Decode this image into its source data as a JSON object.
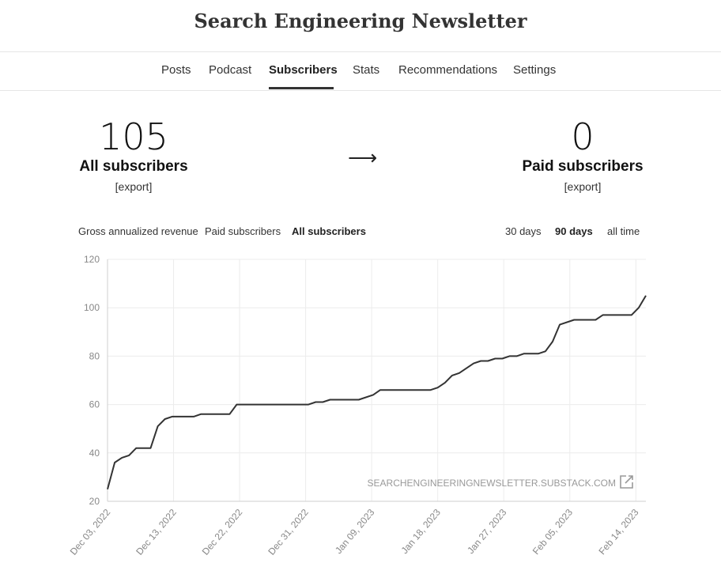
{
  "header": {
    "title": "Search Engineering Newsletter"
  },
  "nav": {
    "items": [
      "Posts",
      "Podcast",
      "Subscribers",
      "Stats",
      "Recommendations",
      "Settings"
    ],
    "active": "Subscribers"
  },
  "stats": {
    "all": {
      "value": "105",
      "label": "All subscribers",
      "export": "[export]"
    },
    "arrow": "⟶",
    "paid": {
      "value": "0",
      "label": "Paid subscribers",
      "export": "[export]"
    }
  },
  "metric_tabs": {
    "items": [
      "Gross annualized revenue",
      "Paid subscribers",
      "All subscribers"
    ],
    "active": "All subscribers"
  },
  "range_tabs": {
    "items": [
      "30 days",
      "90 days",
      "all time"
    ],
    "active": "90 days"
  },
  "watermark": "SEARCHENGINEERINGNEWSLETTER.SUBSTACK.COM",
  "chart_data": {
    "type": "line",
    "ylim": [
      20,
      120
    ],
    "yticks": [
      20,
      40,
      60,
      80,
      100,
      120
    ],
    "xticks": [
      "Dec 03, 2022",
      "Dec 13, 2022",
      "Dec 22, 2022",
      "Dec 31, 2022",
      "Jan 09, 2023",
      "Jan 18, 2023",
      "Jan 27, 2023",
      "Feb 05, 2023",
      "Feb 14, 2023"
    ],
    "x_start": "2022-12-03",
    "x_end": "2023-02-15",
    "grid": true,
    "series": [
      {
        "color": "#333333",
        "points": [
          [
            "2022-12-03",
            25
          ],
          [
            "2022-12-04",
            36
          ],
          [
            "2022-12-05",
            38
          ],
          [
            "2022-12-06",
            39
          ],
          [
            "2022-12-07",
            42
          ],
          [
            "2022-12-09",
            42
          ],
          [
            "2022-12-10",
            51
          ],
          [
            "2022-12-11",
            54
          ],
          [
            "2022-12-12",
            55
          ],
          [
            "2022-12-15",
            55
          ],
          [
            "2022-12-16",
            56
          ],
          [
            "2022-12-20",
            56
          ],
          [
            "2022-12-21",
            60
          ],
          [
            "2022-12-31",
            60
          ],
          [
            "2023-01-01",
            61
          ],
          [
            "2023-01-02",
            61
          ],
          [
            "2023-01-03",
            62
          ],
          [
            "2023-01-07",
            62
          ],
          [
            "2023-01-09",
            64
          ],
          [
            "2023-01-10",
            66
          ],
          [
            "2023-01-17",
            66
          ],
          [
            "2023-01-18",
            67
          ],
          [
            "2023-01-19",
            69
          ],
          [
            "2023-01-20",
            72
          ],
          [
            "2023-01-21",
            73
          ],
          [
            "2023-01-22",
            75
          ],
          [
            "2023-01-23",
            77
          ],
          [
            "2023-01-24",
            78
          ],
          [
            "2023-01-25",
            78
          ],
          [
            "2023-01-26",
            79
          ],
          [
            "2023-01-27",
            79
          ],
          [
            "2023-01-28",
            80
          ],
          [
            "2023-01-29",
            80
          ],
          [
            "2023-01-30",
            81
          ],
          [
            "2023-02-01",
            81
          ],
          [
            "2023-02-02",
            82
          ],
          [
            "2023-02-03",
            86
          ],
          [
            "2023-02-04",
            93
          ],
          [
            "2023-02-06",
            95
          ],
          [
            "2023-02-09",
            95
          ],
          [
            "2023-02-10",
            97
          ],
          [
            "2023-02-14",
            97
          ],
          [
            "2023-02-15",
            100
          ],
          [
            "2023-02-16",
            105
          ]
        ]
      }
    ]
  }
}
